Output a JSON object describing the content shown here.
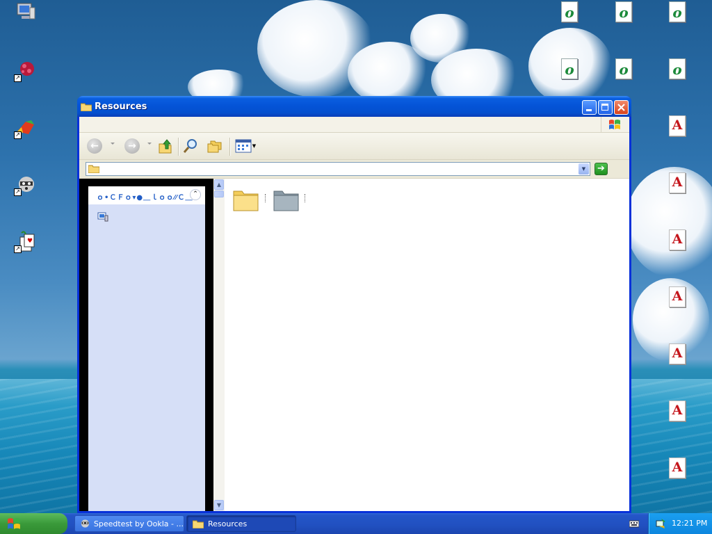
{
  "window": {
    "title": "Resources",
    "address_value": "",
    "task_panel_header": "ｏ•ＣＦｏ▾●＿ｌｏｏ⁄⁄Ｃ＿"
  },
  "taskbar": {
    "tasks": [
      {
        "label": "Speedtest by Ookla - ...",
        "icon": "raccoon-icon"
      },
      {
        "label": "Resources",
        "icon": "folder-icon"
      }
    ],
    "clock": "12:21 PM"
  },
  "desktop": {
    "left_icons": [
      "my-computer-icon",
      "virus-program-icon",
      "ball-app-icon",
      "raccoon-icon",
      "solitaire-icon"
    ],
    "right_icons_o_label": "o",
    "right_icons_a_label": "A"
  },
  "colors": {
    "titlebar": "#0453d6",
    "taskbar": "#2150c0",
    "start_button": "#3a9a3a",
    "task_panel": "#d6dff7",
    "tray": "#0d86de"
  }
}
